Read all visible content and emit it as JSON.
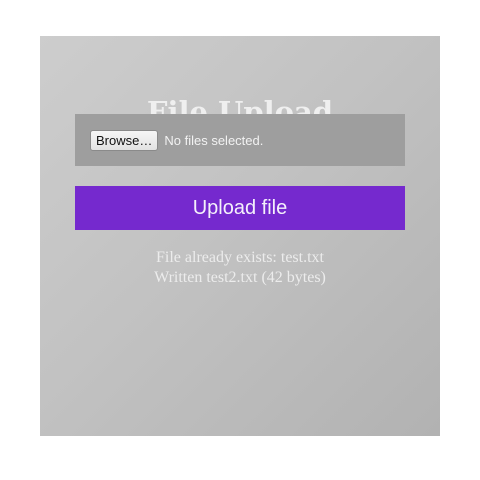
{
  "page": {
    "title": "File Upload"
  },
  "file_input": {
    "button_label": "Browse…",
    "status": "No files selected."
  },
  "upload": {
    "button_label": "Upload file"
  },
  "messages": [
    "File already exists: test.txt",
    "Written test2.txt (42 bytes)"
  ],
  "colors": {
    "upload_button": "#7529ce",
    "file_box": "#9e9e9e",
    "card_light": "#cdcdcd",
    "card_dark": "#b2b2b2"
  }
}
